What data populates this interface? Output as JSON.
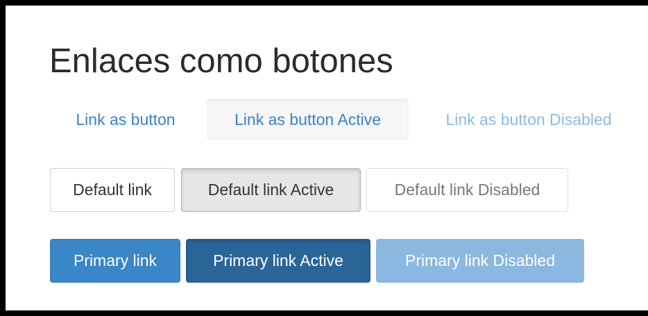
{
  "page": {
    "title": "Enlaces como botones"
  },
  "link_buttons": {
    "normal": "Link as button",
    "active": "Link as button Active",
    "disabled": "Link as button Disabled"
  },
  "default_buttons": {
    "normal": "Default link",
    "active": "Default link Active",
    "disabled": "Default link Disabled"
  },
  "primary_buttons": {
    "normal": "Primary link",
    "active": "Primary link Active",
    "disabled": "Primary link Disabled"
  },
  "colors": {
    "link": "#3a82c4",
    "primary": "#3a86c6",
    "primary_active": "#2a6598",
    "primary_disabled": "#8bb7e0",
    "frame_border": "#000000"
  }
}
